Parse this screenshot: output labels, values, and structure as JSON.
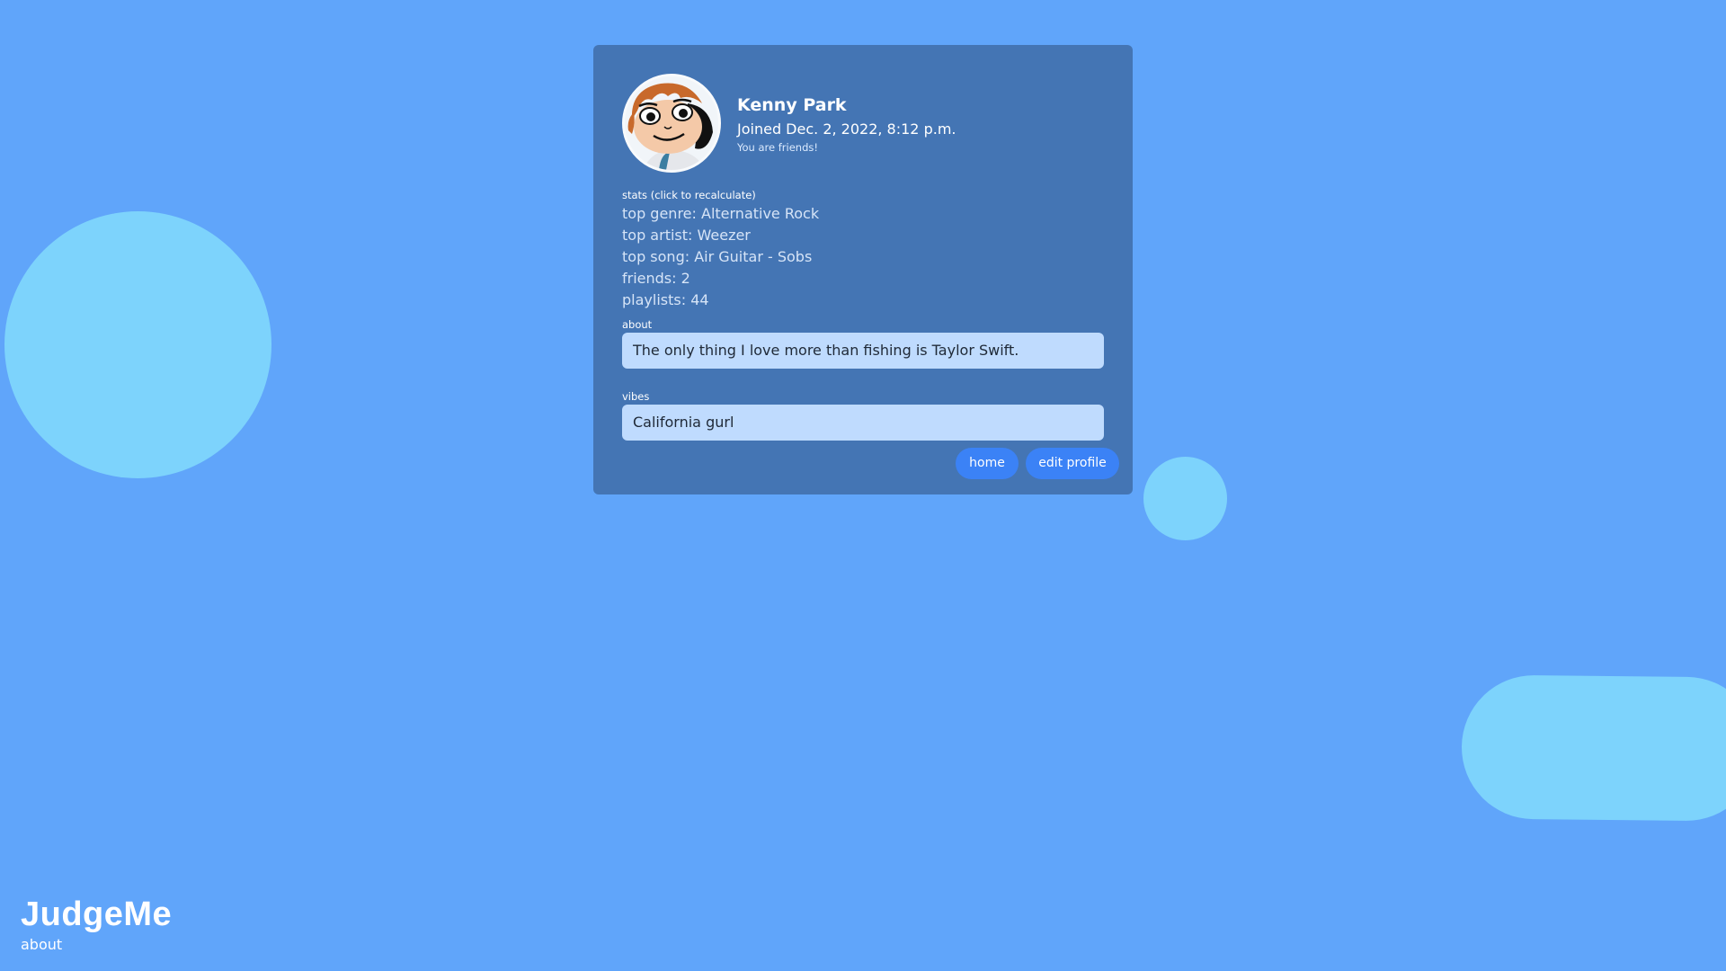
{
  "colors": {
    "background": "#60a5fa",
    "card": "#4475b4",
    "blob": "#7dd3fc",
    "input_bg": "#bfdbfe",
    "button": "#3b82f6"
  },
  "profile": {
    "avatar_icon": "cartoon-avatar",
    "name": "Kenny Park",
    "joined": "Joined Dec. 2, 2022, 8:12 p.m.",
    "friend_status": "You are friends!"
  },
  "stats": {
    "label": "stats (click to recalculate)",
    "items": [
      "top genre: Alternative Rock",
      "top artist: Weezer",
      "top song: Air Guitar - Sobs",
      "friends: 2",
      "playlists: 44"
    ]
  },
  "about": {
    "label": "about",
    "value": "The only thing I love more than fishing is Taylor Swift."
  },
  "vibes": {
    "label": "vibes",
    "value": "California gurl"
  },
  "buttons": {
    "home": "home",
    "edit_profile": "edit profile"
  },
  "footer": {
    "brand": "JudgeMe",
    "about_link": "about"
  }
}
